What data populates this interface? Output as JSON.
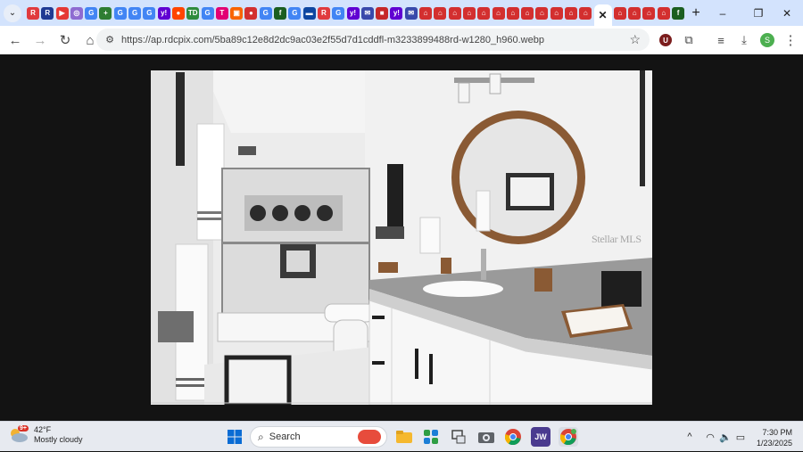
{
  "browser": {
    "tabs": [
      {
        "icon": "realtor-r-icon",
        "glyph": "R",
        "color": "#e03a3e"
      },
      {
        "icon": "redfin-icon",
        "glyph": "R",
        "color": "#1f3a93"
      },
      {
        "icon": "youtube-icon",
        "glyph": "▶",
        "color": "#e53935"
      },
      {
        "icon": "camera-icon",
        "glyph": "◎",
        "color": "#8e6bd1"
      },
      {
        "icon": "google-icon",
        "glyph": "G",
        "color": "#4285f4"
      },
      {
        "icon": "plus-app-icon",
        "glyph": "+",
        "color": "#2e7d32"
      },
      {
        "icon": "google-icon",
        "glyph": "G",
        "color": "#4285f4"
      },
      {
        "icon": "google-icon",
        "glyph": "G",
        "color": "#4285f4"
      },
      {
        "icon": "google-icon",
        "glyph": "G",
        "color": "#4285f4"
      },
      {
        "icon": "yahoo-icon",
        "glyph": "y!",
        "color": "#6001d2"
      },
      {
        "icon": "reddit-icon",
        "glyph": "●",
        "color": "#ff4500"
      },
      {
        "icon": "td-icon",
        "glyph": "TD",
        "color": "#2e8b3d"
      },
      {
        "icon": "google-icon",
        "glyph": "G",
        "color": "#4285f4"
      },
      {
        "icon": "tmobile-icon",
        "glyph": "T",
        "color": "#e20074"
      },
      {
        "icon": "home-depot-icon",
        "glyph": "▣",
        "color": "#f96302"
      },
      {
        "icon": "red-circle-icon",
        "glyph": "●",
        "color": "#d32f2f"
      },
      {
        "icon": "google-icon",
        "glyph": "G",
        "color": "#4285f4"
      },
      {
        "icon": "f-site-icon",
        "glyph": "f",
        "color": "#1b5e20"
      },
      {
        "icon": "google-icon",
        "glyph": "G",
        "color": "#4285f4"
      },
      {
        "icon": "bank-icon",
        "glyph": "▬",
        "color": "#0d47a1"
      },
      {
        "icon": "realtor-r-icon",
        "glyph": "R",
        "color": "#e03a3e"
      },
      {
        "icon": "google-icon",
        "glyph": "G",
        "color": "#4285f4"
      },
      {
        "icon": "yahoo-icon",
        "glyph": "y!",
        "color": "#6001d2"
      },
      {
        "icon": "mail-icon",
        "glyph": "✉",
        "color": "#3949ab"
      },
      {
        "icon": "red-square-icon",
        "glyph": "■",
        "color": "#c62828"
      },
      {
        "icon": "yahoo-icon",
        "glyph": "y!",
        "color": "#6001d2"
      },
      {
        "icon": "mail-icon",
        "glyph": "✉",
        "color": "#3949ab"
      },
      {
        "icon": "house-listing-icon",
        "glyph": "⌂",
        "color": "#d32f2f"
      },
      {
        "icon": "house-listing-icon",
        "glyph": "⌂",
        "color": "#d32f2f"
      },
      {
        "icon": "house-listing-icon",
        "glyph": "⌂",
        "color": "#d32f2f"
      },
      {
        "icon": "house-listing-icon",
        "glyph": "⌂",
        "color": "#d32f2f"
      },
      {
        "icon": "house-listing-icon",
        "glyph": "⌂",
        "color": "#d32f2f"
      },
      {
        "icon": "house-listing-icon",
        "glyph": "⌂",
        "color": "#d32f2f"
      },
      {
        "icon": "house-listing-icon",
        "glyph": "⌂",
        "color": "#d32f2f"
      },
      {
        "icon": "house-listing-icon",
        "glyph": "⌂",
        "color": "#d32f2f"
      },
      {
        "icon": "house-listing-icon",
        "glyph": "⌂",
        "color": "#d32f2f"
      },
      {
        "icon": "house-listing-icon",
        "glyph": "⌂",
        "color": "#d32f2f"
      },
      {
        "icon": "house-listing-icon",
        "glyph": "⌂",
        "color": "#d32f2f"
      },
      {
        "icon": "house-listing-icon",
        "glyph": "⌂",
        "color": "#d32f2f"
      },
      {
        "icon": "close-icon",
        "glyph": "✕",
        "color": "#ffffff",
        "active": true
      },
      {
        "icon": "house-listing-icon",
        "glyph": "⌂",
        "color": "#d32f2f"
      },
      {
        "icon": "house-listing-icon",
        "glyph": "⌂",
        "color": "#d32f2f"
      },
      {
        "icon": "house-listing-icon",
        "glyph": "⌂",
        "color": "#d32f2f"
      },
      {
        "icon": "house-listing-icon",
        "glyph": "⌂",
        "color": "#d32f2f"
      },
      {
        "icon": "f-site-icon",
        "glyph": "f",
        "color": "#1b5e20"
      }
    ],
    "new_tab_glyph": "+",
    "window_controls": {
      "minimize": "–",
      "restore": "❐",
      "close": "✕"
    },
    "nav": {
      "back": "←",
      "forward": "→",
      "reload": "↻",
      "home": "⌂"
    },
    "address": {
      "url": "https://ap.rdcpix.com/5ba89c12e8d2dc9ac03e2f55d7d1cddfl-m3233899488rd-w1280_h960.webp",
      "tune_glyph": "⚙",
      "star_glyph": "☆"
    },
    "toolbar_right": {
      "ext_u_label": "U",
      "puzzle_glyph": "⧉",
      "media_glyph": "≡",
      "download_glyph": "⤓",
      "profile_initial": "S",
      "menu_glyph": "⋮"
    }
  },
  "image": {
    "watermark": "Stellar MLS",
    "subject": "bathroom-photo"
  },
  "taskbar": {
    "weather": {
      "temp": "42°F",
      "condition": "Mostly cloudy",
      "badge": "9+"
    },
    "search_label": "Search",
    "apps": [
      {
        "name": "start-icon"
      },
      {
        "name": "file-explorer-icon"
      },
      {
        "name": "widgets-app-icon"
      },
      {
        "name": "device-app-icon"
      },
      {
        "name": "camera-app-icon"
      },
      {
        "name": "chrome-icon"
      },
      {
        "name": "jw-app-icon",
        "label": "JW"
      },
      {
        "name": "chrome-profile-icon"
      }
    ],
    "tray": {
      "chevron": "^",
      "wifi": "◠",
      "volume": "🔈",
      "battery": "▭"
    },
    "clock": {
      "time": "7:30 PM",
      "date": "1/23/2025"
    }
  },
  "colors": {
    "tabstrip_bg": "#d3e3fd",
    "page_bg": "#131313",
    "taskbar_bg": "#e7eaf0",
    "countertop": "#9a9a9a",
    "mirror_frame": "#8a5a34"
  }
}
